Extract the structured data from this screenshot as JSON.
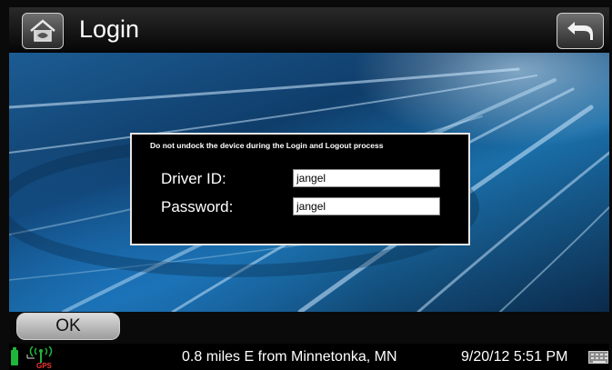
{
  "header": {
    "title": "Login",
    "home_icon": "home-icon",
    "back_icon": "back-arrow-icon"
  },
  "dialog": {
    "notice": "Do not undock the device during the Login and Logout process",
    "driver_label": "Driver ID:",
    "driver_value": "jangel",
    "password_label": "Password:",
    "password_value": "jangel"
  },
  "actions": {
    "ok_label": "OK"
  },
  "status_bar": {
    "gps_label": "GPS",
    "location": "0.8 miles E from Minnetonka, MN",
    "datetime": "9/20/12 5:51 PM",
    "icons": [
      "battery-icon",
      "gps-signal-icon",
      "keyboard-icon"
    ],
    "battery_color": "#1fb53a",
    "signal_color": "#1fb53a"
  }
}
